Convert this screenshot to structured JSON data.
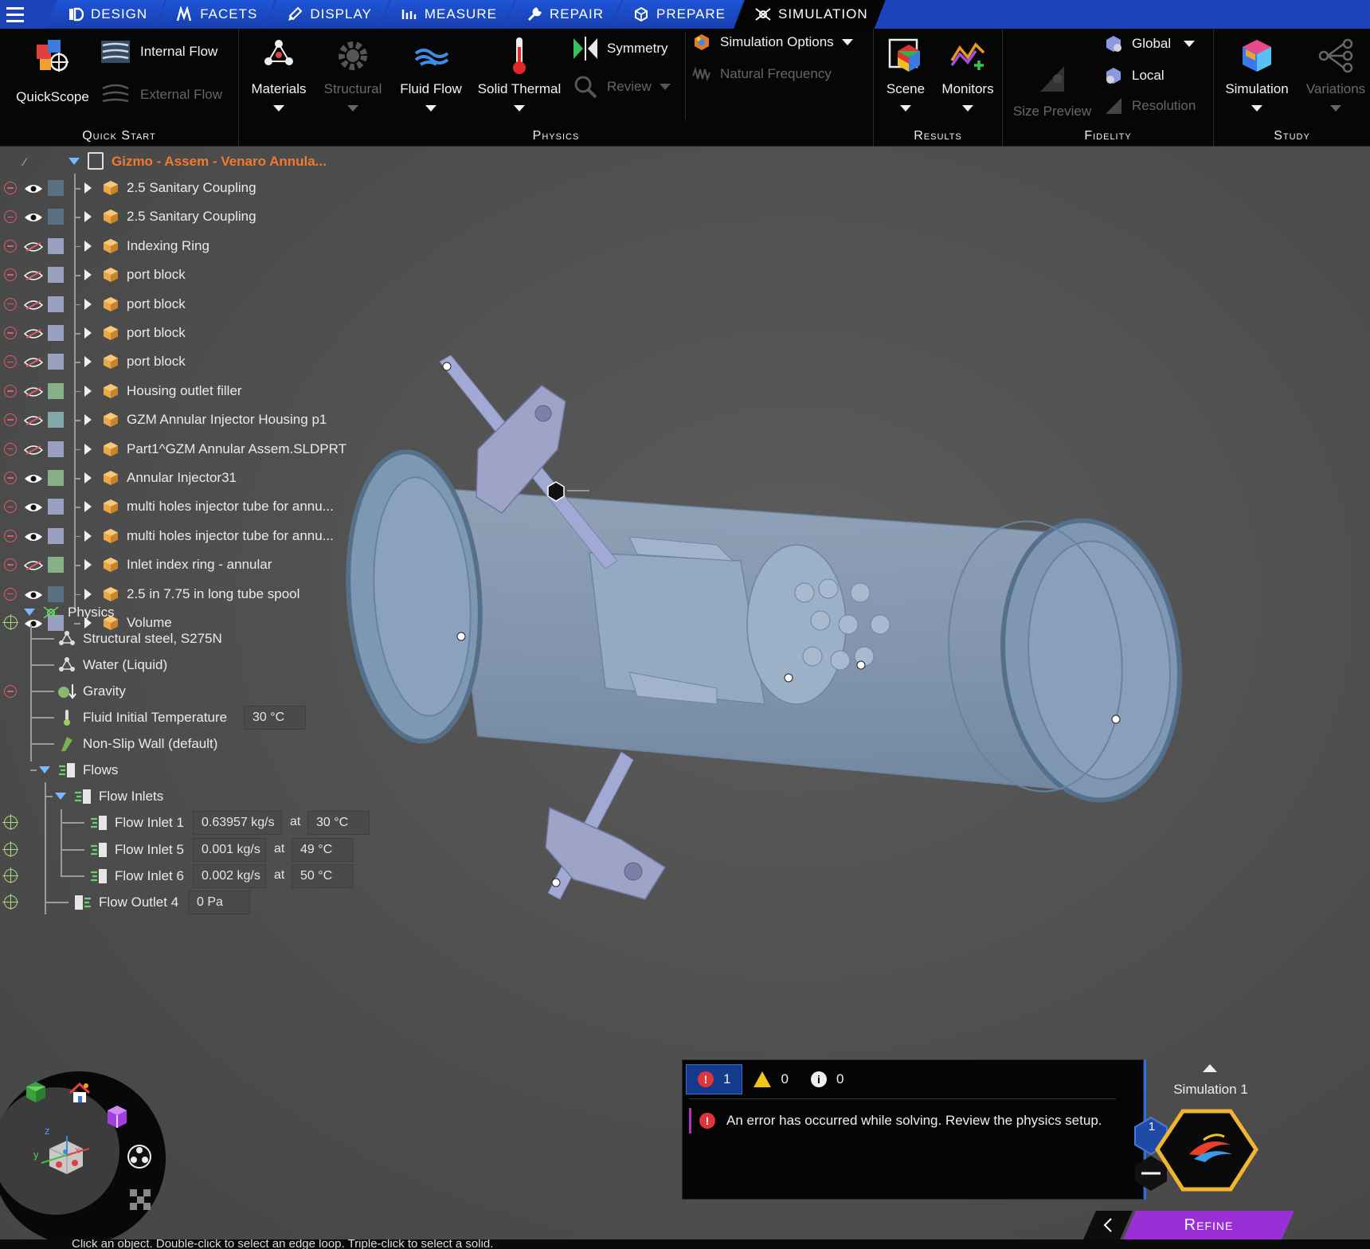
{
  "tabs": [
    {
      "label": "Design",
      "icon": "design-icon"
    },
    {
      "label": "Facets",
      "icon": "facets-icon"
    },
    {
      "label": "Display",
      "icon": "display-icon"
    },
    {
      "label": "Measure",
      "icon": "measure-icon"
    },
    {
      "label": "Repair",
      "icon": "repair-icon"
    },
    {
      "label": "Prepare",
      "icon": "prepare-icon"
    },
    {
      "label": "Simulation",
      "icon": "simulation-icon",
      "active": true
    }
  ],
  "ribbon": {
    "quick_start": {
      "group_label": "Quick Start",
      "quickscope": "QuickScope",
      "internal_flow": "Internal Flow",
      "external_flow": "External Flow"
    },
    "physics": {
      "group_label": "Physics",
      "materials": "Materials",
      "structural": "Structural",
      "fluid_flow": "Fluid Flow",
      "solid_thermal": "Solid Thermal",
      "symmetry": "Symmetry",
      "review": "Review",
      "simulation_options": "Simulation Options",
      "natural_frequency": "Natural Frequency"
    },
    "results": {
      "group_label": "Results",
      "scene": "Scene",
      "monitors": "Monitors"
    },
    "fidelity": {
      "group_label": "Fidelity",
      "size_preview": "Size Preview",
      "global": "Global",
      "local": "Local",
      "resolution": "Resolution"
    },
    "study": {
      "group_label": "Study",
      "simulation": "Simulation",
      "variations": "Variations"
    }
  },
  "tree": {
    "root": "Gizmo - Assem - Venaro Annula...",
    "parts": [
      {
        "label": "2.5 Sanitary Coupling",
        "visible": true,
        "color": "#5a7080"
      },
      {
        "label": "2.5 Sanitary Coupling",
        "visible": true,
        "color": "#5a7080"
      },
      {
        "label": "Indexing Ring",
        "visible": false,
        "color": "#9aa0c0"
      },
      {
        "label": "port block",
        "visible": false,
        "color": "#9aa0c0"
      },
      {
        "label": "port block",
        "visible": false,
        "color": "#9aa0c0"
      },
      {
        "label": "port block",
        "visible": false,
        "color": "#9aa0c0"
      },
      {
        "label": "port block",
        "visible": false,
        "color": "#9aa0c0"
      },
      {
        "label": "Housing outlet filler",
        "visible": false,
        "color": "#88b088"
      },
      {
        "label": "GZM Annular Injector Housing p1",
        "visible": false,
        "color": "#80a8a8"
      },
      {
        "label": "Part1^GZM Annular Assem.SLDPRT",
        "visible": false,
        "color": "#9aa0c0"
      },
      {
        "label": "Annular Injector31",
        "visible": true,
        "color": "#88b088"
      },
      {
        "label": "multi holes injector tube for annu...",
        "visible": true,
        "color": "#9aa0c0"
      },
      {
        "label": "multi holes injector tube for annu...",
        "visible": true,
        "color": "#9aa0c0"
      },
      {
        "label": "Inlet index ring - annular",
        "visible": false,
        "color": "#88b088"
      },
      {
        "label": "2.5 in 7.75 in long tube spool",
        "visible": true,
        "color": "#5a7080"
      },
      {
        "label": "Volume",
        "visible": true,
        "color": "#9aa0c0"
      }
    ],
    "physics": {
      "label": "Physics",
      "structural_material": "Structural steel, S275N",
      "fluid_material": "Water (Liquid)",
      "gravity": "Gravity",
      "fluid_temp_label": "Fluid Initial Temperature",
      "fluid_temp_value": "30 °C",
      "wall": "Non-Slip Wall (default)",
      "flows": "Flows",
      "flow_inlets": "Flow Inlets",
      "at": "at",
      "inlets": [
        {
          "label": "Flow Inlet 1",
          "rate": "0.63957 kg/s",
          "temp": "30 °C"
        },
        {
          "label": "Flow Inlet 5",
          "rate": "0.001 kg/s",
          "temp": "49 °C"
        },
        {
          "label": "Flow Inlet 6",
          "rate": "0.002 kg/s",
          "temp": "50 °C"
        }
      ],
      "outlet": {
        "label": "Flow Outlet 4",
        "value": "0 Pa"
      }
    }
  },
  "messages": {
    "error_count": "1",
    "warning_count": "0",
    "info_count": "0",
    "error_text": "An error has occurred while solving. Review the physics setup."
  },
  "simulation": {
    "label": "Simulation 1",
    "badge": "1",
    "refine": "Refine"
  },
  "status": {
    "text": "Click an object. Double-click to select an edge loop. Triple-click to select a solid."
  },
  "nav": {
    "axis_z": "z",
    "axis_y": "y",
    "axis_x": "x"
  },
  "colors": {
    "accent": "#1a44b8",
    "refine": "#9b2fd6",
    "error": "#e0343a",
    "root_label": "#f07a30"
  }
}
